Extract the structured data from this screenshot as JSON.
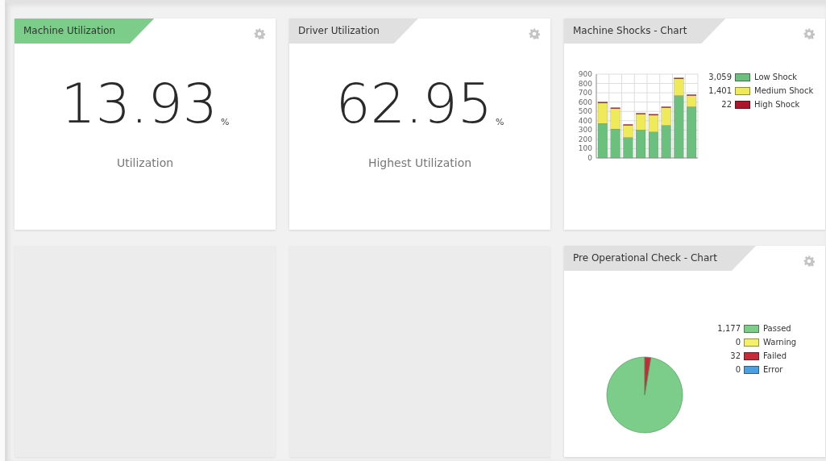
{
  "cards": [
    {
      "kind": "metric",
      "title": "Machine Utilization",
      "selected": true,
      "value": "13.93",
      "unit": "%",
      "label": "Utilization"
    },
    {
      "kind": "metric",
      "title": "Driver Utilization",
      "selected": false,
      "value": "62.95",
      "unit": "%",
      "label": "Highest Utilization"
    },
    {
      "kind": "bar",
      "title": "Machine Shocks - Chart",
      "selected": false,
      "totals": [
        "3,059",
        "1,401",
        "22"
      ],
      "chart_data": {
        "type": "bar",
        "stacked": true,
        "grid": true,
        "ylim": [
          0,
          900
        ],
        "yticks": [
          0,
          100,
          200,
          300,
          400,
          500,
          600,
          700,
          800,
          900
        ],
        "series": [
          {
            "name": "Low Shock",
            "color": "#6cc07e",
            "values": [
              370,
              310,
              220,
              300,
              280,
              350,
              670,
              550
            ]
          },
          {
            "name": "Medium Shock",
            "color": "#eeea5a",
            "values": [
              220,
              220,
              130,
              170,
              180,
              190,
              180,
              120
            ]
          },
          {
            "name": "High Shock",
            "color": "#b0142a",
            "values": [
              10,
              10,
              10,
              10,
              10,
              10,
              10,
              10
            ]
          }
        ]
      }
    },
    {
      "kind": "empty"
    },
    {
      "kind": "empty"
    },
    {
      "kind": "pie",
      "title": "Pre Operational Check - Chart",
      "selected": false,
      "legend": [
        {
          "value": "1,177",
          "color": "#7dcd8a"
        },
        {
          "value": "0",
          "color": "#f4f06a"
        },
        {
          "value": "32",
          "color": "#c42c3c"
        },
        {
          "value": "0",
          "color": "#4aa0e0"
        }
      ],
      "chart_data": {
        "type": "pie",
        "categories": [
          "Passed",
          "Warning",
          "Failed",
          "Error"
        ],
        "values": [
          97.4,
          0,
          2.6,
          0
        ]
      }
    }
  ]
}
